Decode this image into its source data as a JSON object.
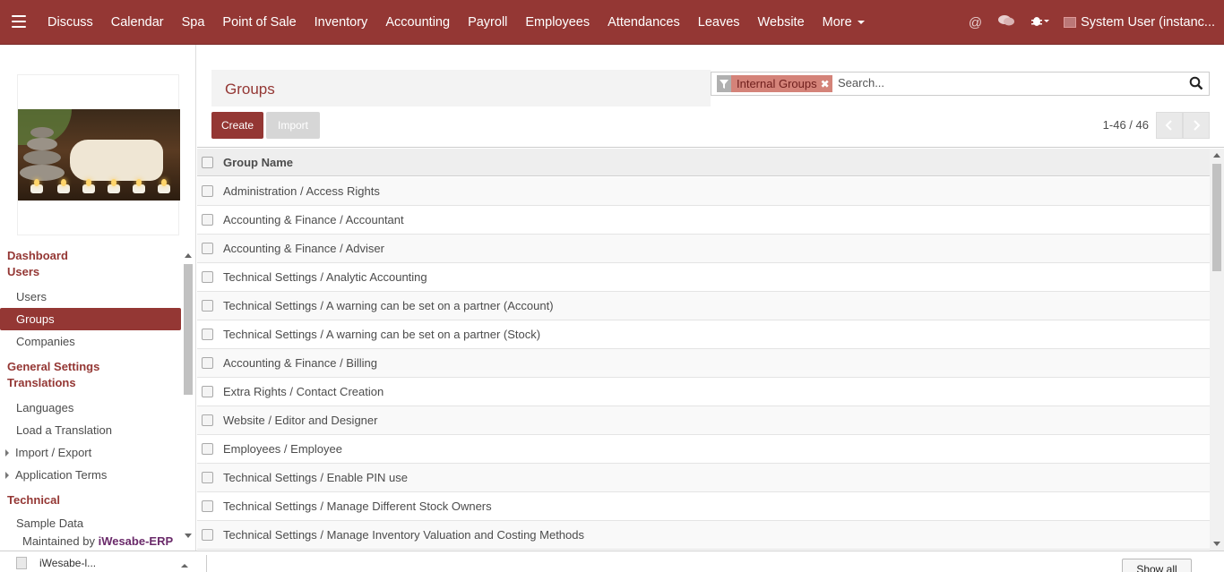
{
  "topnav": {
    "menu_items": [
      "Discuss",
      "Calendar",
      "Spa",
      "Point of Sale",
      "Inventory",
      "Accounting",
      "Payroll",
      "Employees",
      "Attendances",
      "Leaves",
      "Website",
      "More"
    ],
    "user_label": "System User (instanc...",
    "icons": [
      "menu-icon",
      "at-icon",
      "chat-icon",
      "bug-icon"
    ]
  },
  "sidebar": {
    "sections": [
      {
        "header": "Dashboard",
        "items": []
      },
      {
        "header": "Users",
        "items": [
          "Users",
          "Groups",
          "Companies"
        ]
      },
      {
        "header": "General Settings",
        "items": []
      },
      {
        "header": "Translations",
        "items": [
          "Languages",
          "Load a Translation",
          "Import / Export",
          "Application Terms"
        ]
      },
      {
        "header": "Technical",
        "items": [
          "Sample Data"
        ]
      }
    ],
    "active_item": "Groups",
    "maintained_prefix": "Maintained by",
    "maintained_brand": "iWesabe-ERP"
  },
  "control_panel": {
    "breadcrumb": "Groups",
    "facet_label": "Internal Groups",
    "search_placeholder": "Search...",
    "create_label": "Create",
    "import_label": "Import",
    "pager_value": "1-46 / 46"
  },
  "table": {
    "column_header": "Group Name",
    "rows": [
      "Administration / Access Rights",
      "Accounting & Finance / Accountant",
      "Accounting & Finance / Adviser",
      "Technical Settings / Analytic Accounting",
      "Technical Settings / A warning can be set on a partner (Account)",
      "Technical Settings / A warning can be set on a partner (Stock)",
      "Accounting & Finance / Billing",
      "Extra Rights / Contact Creation",
      "Website / Editor and Designer",
      "Employees / Employee",
      "Technical Settings / Enable PIN use",
      "Technical Settings / Manage Different Stock Owners",
      "Technical Settings / Manage Inventory Valuation and Costing Methods"
    ]
  },
  "download_bar": {
    "file_label": "iWesabe-l...",
    "show_all_label": "Show all"
  },
  "colors": {
    "brand": "#943734",
    "facet": "#d48379"
  }
}
